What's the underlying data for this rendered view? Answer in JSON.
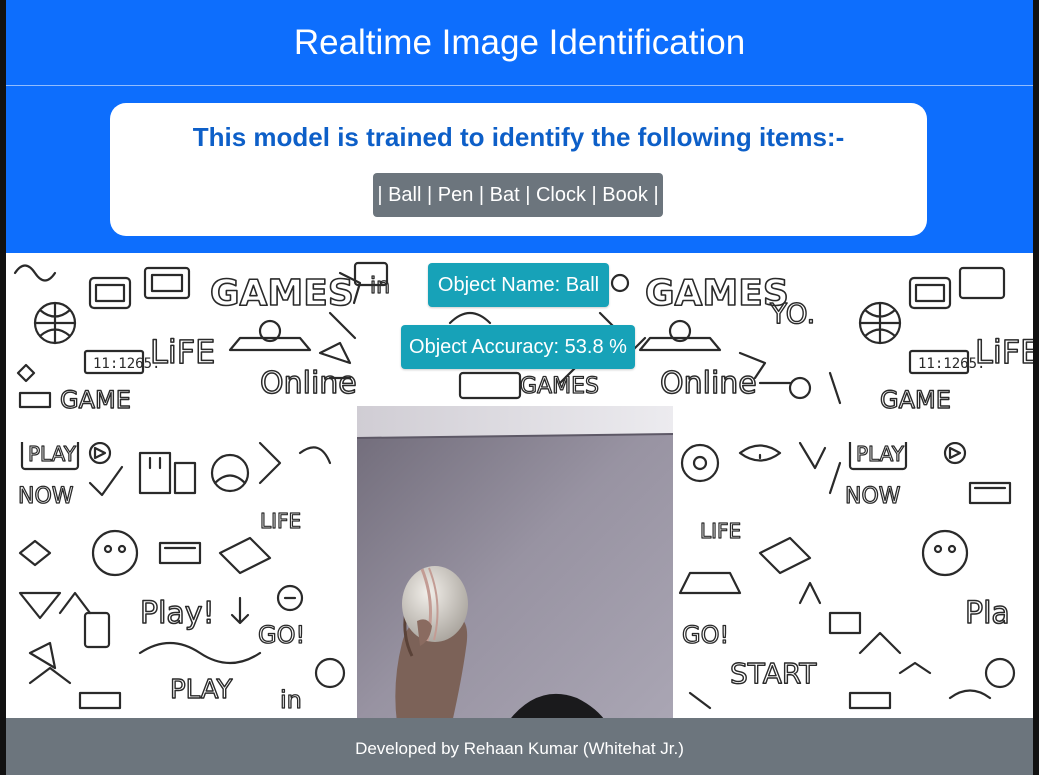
{
  "app": {
    "title": "Realtime Image Identification"
  },
  "info": {
    "heading": "This model is trained to identify the following items:-",
    "items_text": "| Ball | Pen | Bat | Clock | Book |"
  },
  "prediction": {
    "object_name_label": "Object Name: Ball",
    "object_accuracy_label": "Object Accuracy: 53.8 %"
  },
  "footer": {
    "text": "Developed by Rehaan Kumar (Whitehat Jr.)"
  },
  "colors": {
    "header_bg": "#0d6efd",
    "heading_text": "#0d5fc8",
    "badge_gray": "#6c757d",
    "pill_teal": "#17a2b8",
    "footer_bg": "#6c757d"
  },
  "icons": {
    "background_pattern": "doodle-pattern",
    "camera": "webcam-feed"
  }
}
